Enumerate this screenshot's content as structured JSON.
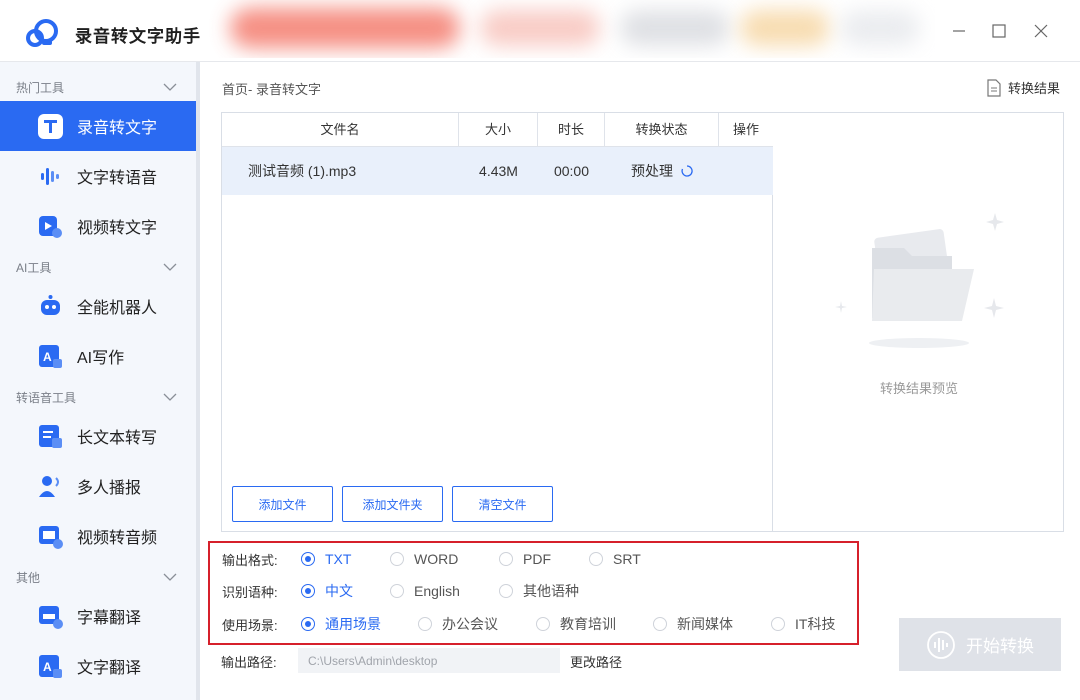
{
  "app": {
    "title": "录音转文字助手"
  },
  "sidebar": {
    "groups": [
      {
        "label": "热门工具"
      },
      {
        "label": "AI工具"
      },
      {
        "label": "转语音工具"
      },
      {
        "label": "其他"
      }
    ],
    "items": [
      {
        "label": "录音转文字",
        "icon": "text-t-icon",
        "active": true
      },
      {
        "label": "文字转语音",
        "icon": "soundwave-icon"
      },
      {
        "label": "视频转文字",
        "icon": "video-play-icon"
      },
      {
        "label": "全能机器人",
        "icon": "robot-icon"
      },
      {
        "label": "AI写作",
        "icon": "ai-write-icon"
      },
      {
        "label": "长文本转写",
        "icon": "long-text-icon"
      },
      {
        "label": "多人播报",
        "icon": "multi-speaker-icon"
      },
      {
        "label": "视频转音频",
        "icon": "video-audio-icon"
      },
      {
        "label": "字幕翻译",
        "icon": "subtitle-translate-icon"
      },
      {
        "label": "文字翻译",
        "icon": "text-translate-icon"
      }
    ]
  },
  "main": {
    "breadcrumb": "首页- 录音转文字",
    "result_button": "转换结果",
    "table": {
      "columns": [
        "文件名",
        "大小",
        "时长",
        "转换状态",
        "操作"
      ],
      "rows": [
        {
          "name": "测试音频 (1).mp3",
          "size": "4.43M",
          "duration": "00:00",
          "status": "预处理"
        }
      ]
    },
    "buttons": {
      "add_file": "添加文件",
      "add_folder": "添加文件夹",
      "clear": "清空文件"
    },
    "preview_text": "转换结果预览"
  },
  "options": {
    "format": {
      "label": "输出格式:",
      "choices": [
        "TXT",
        "WORD",
        "PDF",
        "SRT"
      ],
      "selected": "TXT"
    },
    "language": {
      "label": "识别语种:",
      "choices": [
        "中文",
        "English",
        "其他语种"
      ],
      "selected": "中文"
    },
    "scene": {
      "label": "使用场景:",
      "choices": [
        "通用场景",
        "办公会议",
        "教育培训",
        "新闻媒体",
        "IT科技"
      ],
      "selected": "通用场景"
    }
  },
  "output": {
    "label": "输出路径:",
    "path": "C:\\Users\\Admin\\desktop",
    "change_label": "更改路径"
  },
  "start_button": "开始转换",
  "colors": {
    "accent": "#2a6af2",
    "highlight_border": "#d6202b",
    "row_highlight": "#e9f0fb"
  }
}
